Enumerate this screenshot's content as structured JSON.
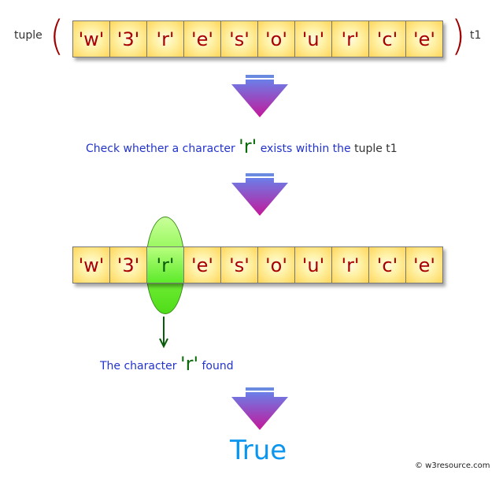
{
  "tuple_label": "tuple",
  "tuple_name": "t1",
  "open_paren": "(",
  "close_paren": ")",
  "elements": [
    "'w'",
    "'3'",
    "'r'",
    "'e'",
    "'s'",
    "'o'",
    "'u'",
    "'r'",
    "'c'",
    "'e'"
  ],
  "highlight_index": 2,
  "step1": {
    "prefix": "Check whether a character",
    "char": "'r'",
    "middle": "exists within the",
    "suffix": "tuple t1"
  },
  "step2": {
    "prefix": "The character",
    "char": "'r'",
    "suffix": "found"
  },
  "result": "True",
  "copyright": "© w3resource.com",
  "colors": {
    "cell_text": "#a80000",
    "highlight_text": "#0a5c0a",
    "message_text": "#2233cc",
    "result_text": "#0a96ef"
  }
}
